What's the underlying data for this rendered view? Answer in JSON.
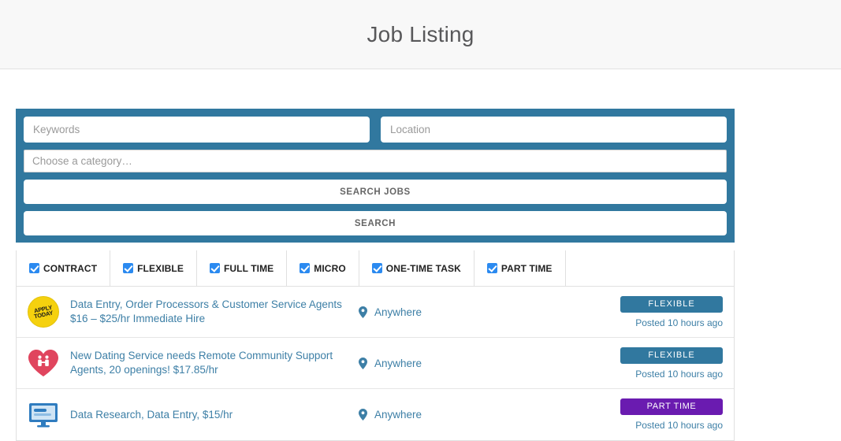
{
  "header": {
    "title": "Job Listing"
  },
  "search": {
    "keywords_placeholder": "Keywords",
    "keywords_value": "",
    "location_placeholder": "Location",
    "location_value": "",
    "category_selected": "Choose a category…",
    "search_jobs_label": "SEARCH JOBS",
    "search_label": "SEARCH",
    "accent_color": "#31789f"
  },
  "filters": [
    {
      "label": "CONTRACT",
      "checked": true
    },
    {
      "label": "FLEXIBLE",
      "checked": true
    },
    {
      "label": "FULL TIME",
      "checked": true
    },
    {
      "label": "MICRO",
      "checked": true
    },
    {
      "label": "ONE-TIME TASK",
      "checked": true
    },
    {
      "label": "PART TIME",
      "checked": true
    }
  ],
  "jobs": [
    {
      "title_line1": "Data Entry, Order Processors & Customer Service Agents",
      "title_line2": "$16 – $25/hr Immediate Hire",
      "location": "Anywhere",
      "badge": "FLEXIBLE",
      "badge_color": "#31789f",
      "posted": "Posted 10 hours ago",
      "logo": "apply-today-sticker",
      "logo_line1": "APPLY",
      "logo_line2": "TODAY"
    },
    {
      "title_line1": "New Dating Service needs Remote Community Support",
      "title_line2": "Agents, 20 openings! $17.85/hr",
      "location": "Anywhere",
      "badge": "FLEXIBLE",
      "badge_color": "#31789f",
      "posted": "Posted 10 hours ago",
      "logo": "heart-couple-icon"
    },
    {
      "title_line1": "Data Research, Data Entry, $15/hr",
      "title_line2": "",
      "location": "Anywhere",
      "badge": "PART TIME",
      "badge_color": "#6a1bb0",
      "posted": "Posted 10 hours ago",
      "logo": "monitor-icon"
    }
  ]
}
